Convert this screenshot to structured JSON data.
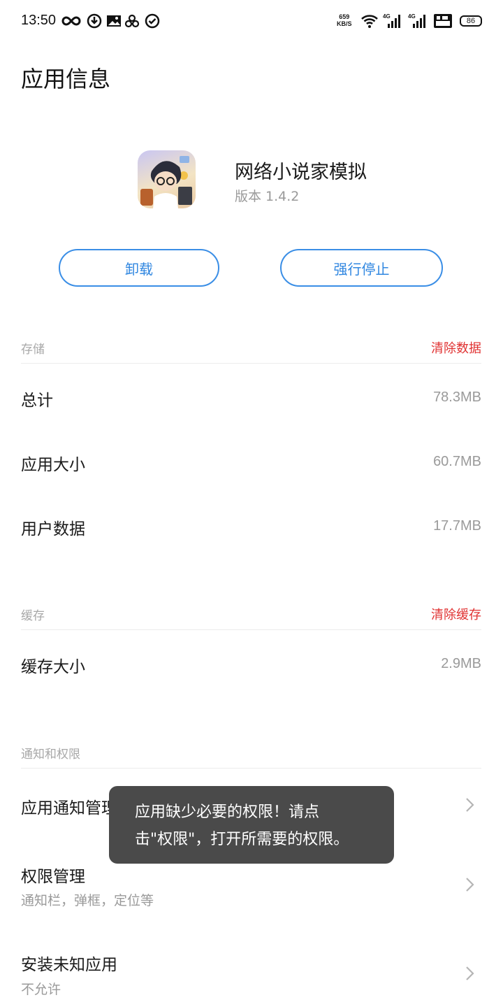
{
  "status_bar": {
    "time": "13:50",
    "net_speed_value": "659",
    "net_speed_unit": "KB/S",
    "battery": "86",
    "network_labels": [
      "4G",
      "4G"
    ]
  },
  "page": {
    "title": "应用信息"
  },
  "app": {
    "name": "网络小说家模拟",
    "version_label": "版本 1.4.2"
  },
  "buttons": {
    "uninstall": "卸载",
    "force_stop": "强行停止"
  },
  "storage": {
    "section_label": "存储",
    "action": "清除数据",
    "rows": [
      {
        "label": "总计",
        "value": "78.3MB"
      },
      {
        "label": "应用大小",
        "value": "60.7MB"
      },
      {
        "label": "用户数据",
        "value": "17.7MB"
      }
    ]
  },
  "cache": {
    "section_label": "缓存",
    "action": "清除缓存",
    "rows": [
      {
        "label": "缓存大小",
        "value": "2.9MB"
      }
    ]
  },
  "permissions": {
    "section_label": "通知和权限",
    "rows": [
      {
        "label": "应用通知管理"
      },
      {
        "label": "权限管理",
        "sub": "通知栏，弹框，定位等"
      },
      {
        "label": "安装未知应用",
        "sub": "不允许"
      }
    ]
  },
  "toast": {
    "line1": "应用缺少必要的权限！请点",
    "line2": "击\"权限\"，打开所需要的权限。"
  },
  "colors": {
    "accent_blue": "#2f86e0",
    "danger_red": "#e03131",
    "toast_bg": "#4a4a4a"
  }
}
